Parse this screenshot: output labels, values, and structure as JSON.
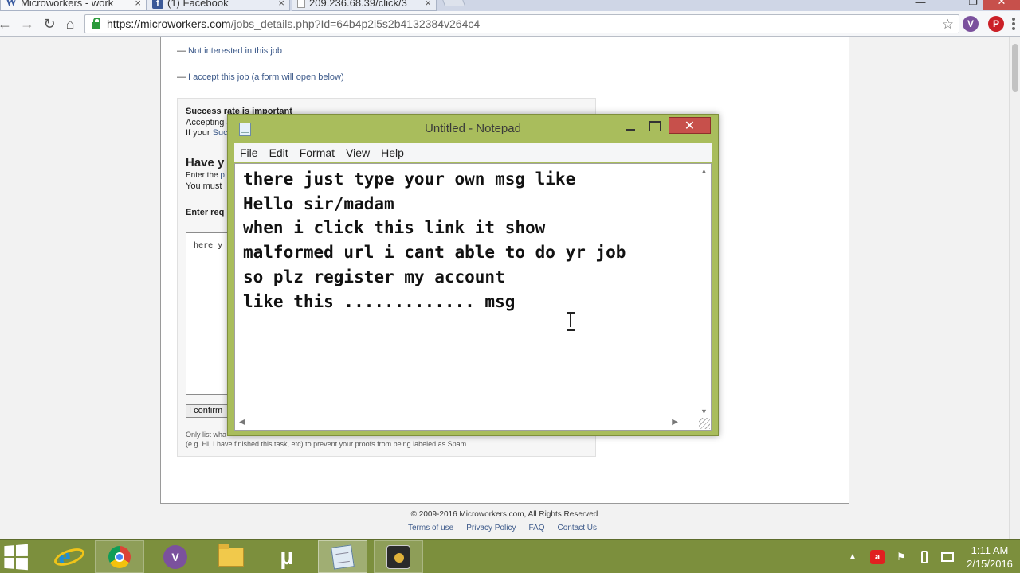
{
  "browser": {
    "tabs": [
      {
        "title": "Microworkers - work",
        "favicon": "W",
        "close": "×"
      },
      {
        "title": "(1) Facebook",
        "favicon": "f",
        "close": "×"
      },
      {
        "title": "209.236.68.39/click/3",
        "favicon": "",
        "close": "×"
      }
    ],
    "address": {
      "host": "https://microworkers.com",
      "path": "/jobs_details.php?Id=64b4p2i5s2b4132384v264c4"
    },
    "extensions": {
      "viber": "V",
      "pinterest": "P"
    },
    "icons": [
      "back-icon",
      "forward-icon",
      "reload-icon",
      "home-icon",
      "lock-icon",
      "star-icon",
      "menu-icon"
    ]
  },
  "page": {
    "not_interested": "Not interested in this job",
    "accept": "I accept this job (a form will open below)",
    "dash": "—",
    "success_heading": "Success rate is important",
    "accepting_text": "Accepting a",
    "if_your_prefix": "If your ",
    "if_your_link": "Suc",
    "have_heading": "Have y",
    "enter_the_prefix": "Enter the ",
    "enter_the_link": "p",
    "you_must": "You must",
    "enter_req": "Enter req",
    "proof_placeholder": "here y",
    "confirm_label": "I confirm",
    "only_list": "Only list wha",
    "eg_text": "(e.g. Hi, I have finished this task, etc) to prevent your proofs from being labeled as Spam.",
    "footer_copy": "© 2009-2016 Microworkers.com, All Rights Reserved",
    "footer_links": [
      "Terms of use",
      "Privacy Policy",
      "FAQ",
      "Contact Us"
    ]
  },
  "notepad": {
    "title": "Untitled - Notepad",
    "close_symbol": "✕",
    "menus": [
      "File",
      "Edit",
      "Format",
      "View",
      "Help"
    ],
    "text": "there just type your own msg like\nHello sir/madam\nwhen i click this link it show\nmalformed url i cant able to do yr job\nso plz register my account\nlike this ............. msg",
    "scroll_up": "▲",
    "scroll_down": "▼",
    "scroll_left": "◀",
    "scroll_right": "▶"
  },
  "taskbar": {
    "apps": [
      "start",
      "internet-explorer",
      "google-chrome",
      "viber",
      "file-explorer",
      "utorrent",
      "notepad",
      "webcam"
    ],
    "utorrent_glyph": "µ",
    "ie_glyph": "e",
    "viber_glyph": "V",
    "avira_glyph": "a",
    "tray_up": "▲",
    "time": "1:11 AM",
    "date": "2/15/2016"
  },
  "colors": {
    "taskbar": "#7c8f3d",
    "notepad_frame": "#a9bd5c",
    "close_red": "#c7504b",
    "link_blue": "#3d5a8a"
  }
}
